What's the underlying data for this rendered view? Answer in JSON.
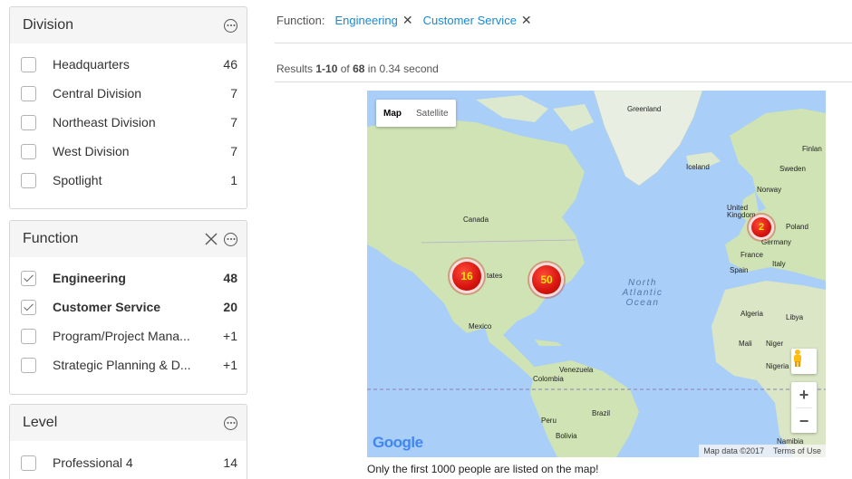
{
  "division": {
    "title": "Division",
    "items": [
      {
        "label": "Headquarters",
        "count": "46"
      },
      {
        "label": "Central Division",
        "count": "7"
      },
      {
        "label": "Northeast Division",
        "count": "7"
      },
      {
        "label": "West Division",
        "count": "7"
      },
      {
        "label": "Spotlight",
        "count": "1"
      }
    ]
  },
  "function": {
    "title": "Function",
    "items": [
      {
        "label": "Engineering",
        "count": "48",
        "checked": true
      },
      {
        "label": "Customer Service",
        "count": "20",
        "checked": true
      },
      {
        "label": "Program/Project Mana...",
        "count": "+1",
        "checked": false
      },
      {
        "label": "Strategic Planning & D...",
        "count": "+1",
        "checked": false
      }
    ]
  },
  "level": {
    "title": "Level",
    "items": [
      {
        "label": "Professional 4",
        "count": "14"
      }
    ]
  },
  "filter_bar": {
    "label": "Function:",
    "chips": [
      "Engineering",
      "Customer Service"
    ]
  },
  "results": {
    "prefix": "Results",
    "range": "1-10",
    "of": "of",
    "total": "68",
    "suffix": "in 0.34 second"
  },
  "map": {
    "type_map": "Map",
    "type_satellite": "Satellite",
    "clusters": [
      "16",
      "50",
      "2"
    ],
    "labels": {
      "greenland": "Greenland",
      "iceland": "Iceland",
      "finland": "Finlan",
      "sweden": "Sweden",
      "norway": "Norway",
      "uk": "United Kingdom",
      "poland": "Poland",
      "germany": "Germany",
      "france": "France",
      "italy": "Italy",
      "spain": "Spain",
      "canada": "Canada",
      "states": "tates",
      "mexico": "Mexico",
      "venezuela": "Venezuela",
      "colombia": "Colombia",
      "brazil": "Brazil",
      "peru": "Peru",
      "bolivia": "Bolivia",
      "algeria": "Algeria",
      "libya": "Libya",
      "mali": "Mali",
      "niger": "Niger",
      "nigeria": "Nigeria",
      "namibia": "Namibia"
    },
    "ocean": "North Atlantic Ocean",
    "google": "Google",
    "map_data": "Map data ©2017",
    "terms": "Terms of Use",
    "note": "Only the first 1000 people are listed on the map!"
  },
  "colors": {
    "link": "#1a8ad0",
    "cluster": "#d6140e",
    "water": "#a9cef7",
    "land": "#cfe3b5"
  }
}
